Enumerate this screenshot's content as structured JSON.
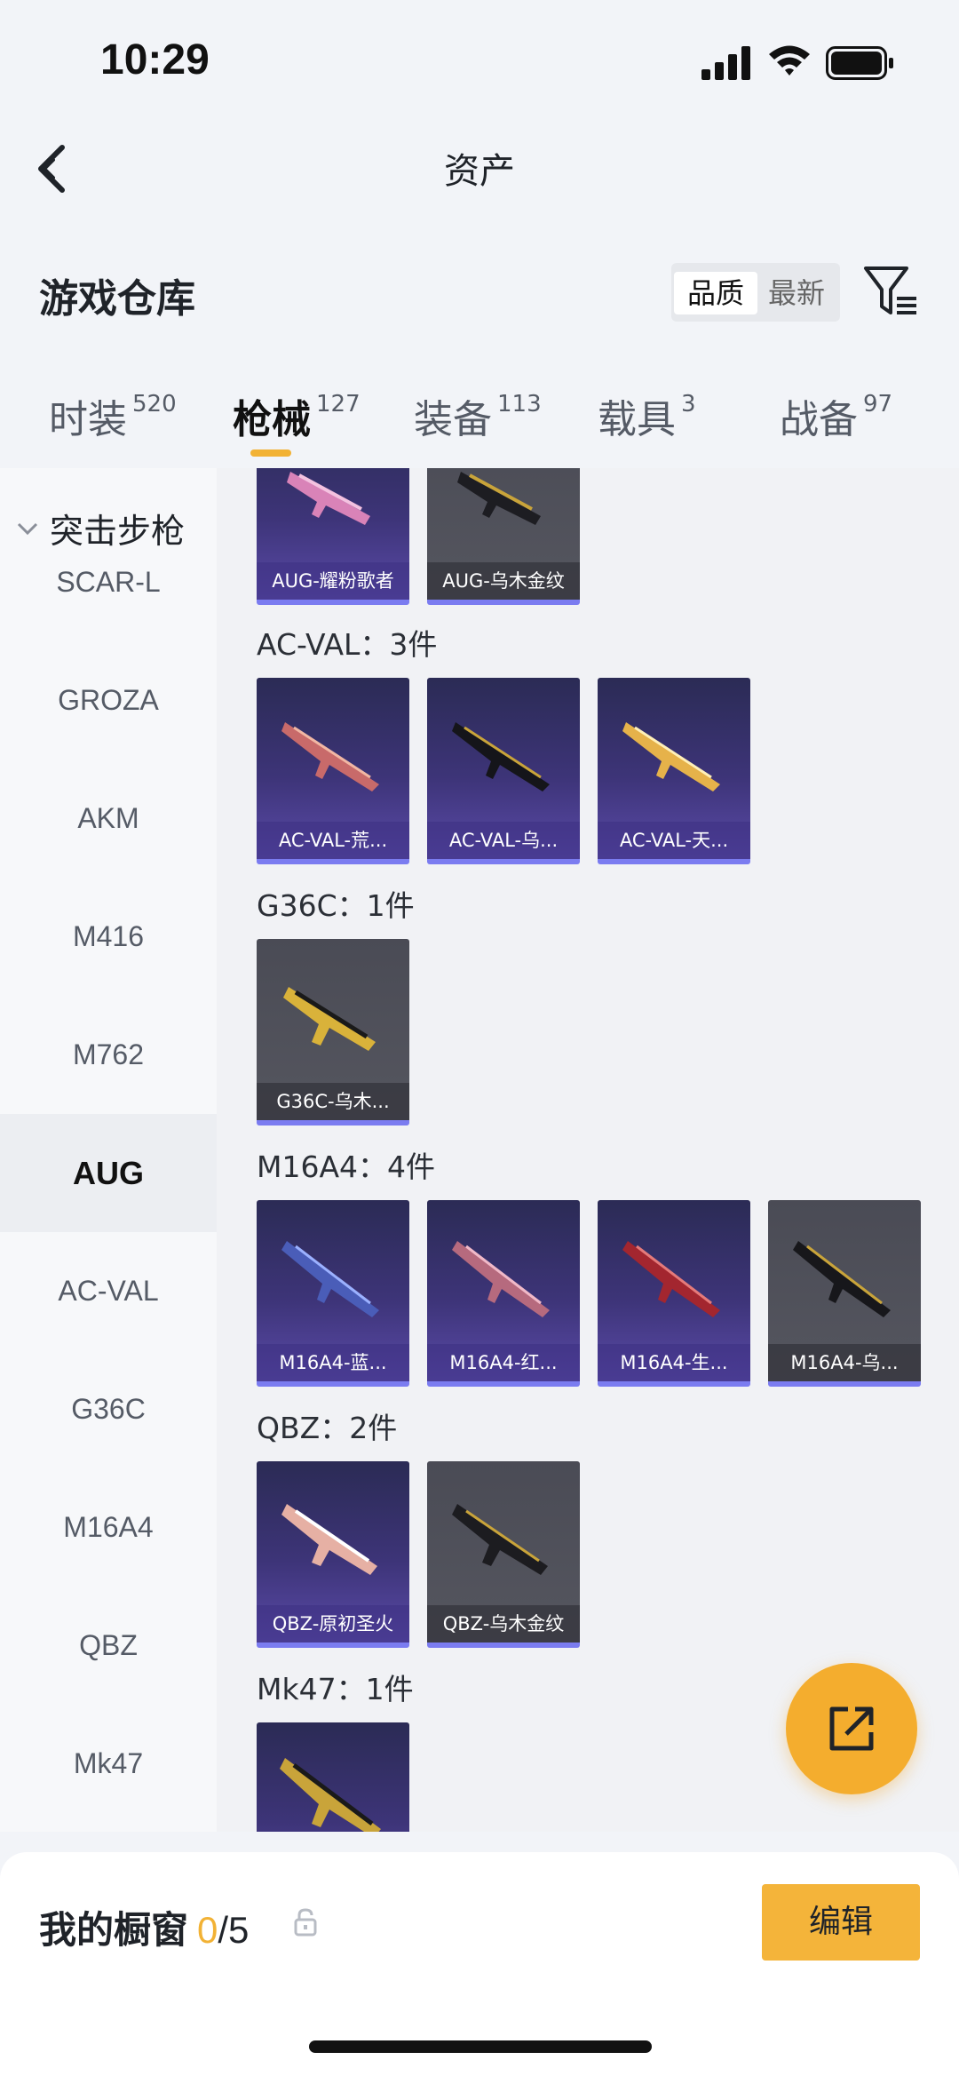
{
  "status": {
    "time": "10:29"
  },
  "nav": {
    "title": "资产"
  },
  "warehouse": {
    "title": "游戏仓库",
    "sort_quality": "品质",
    "sort_latest": "最新"
  },
  "tabs": [
    {
      "label": "时装",
      "count": "520"
    },
    {
      "label": "枪械",
      "count": "127"
    },
    {
      "label": "装备",
      "count": "113"
    },
    {
      "label": "载具",
      "count": "3"
    },
    {
      "label": "战备",
      "count": "97"
    }
  ],
  "sidenav": {
    "group": "突击步枪",
    "items": [
      "SCAR-L",
      "GROZA",
      "AKM",
      "M416",
      "M762",
      "AUG",
      "AC-VAL",
      "G36C",
      "M16A4",
      "QBZ",
      "Mk47"
    ],
    "active": "AUG"
  },
  "sections": [
    {
      "title": "",
      "items": [
        "AUG-耀粉歌者",
        "AUG-乌木金纹"
      ]
    },
    {
      "title": "AC-VAL：3件",
      "items": [
        "AC-VAL-荒...",
        "AC-VAL-乌...",
        "AC-VAL-天..."
      ]
    },
    {
      "title": "G36C：1件",
      "items": [
        "G36C-乌木..."
      ]
    },
    {
      "title": "M16A4：4件",
      "items": [
        "M16A4-蓝...",
        "M16A4-红...",
        "M16A4-生...",
        "M16A4-乌..."
      ]
    },
    {
      "title": "QBZ：2件",
      "items": [
        "QBZ-原初圣火",
        "QBZ-乌木金纹"
      ]
    },
    {
      "title": "Mk47：1件",
      "items": [
        ""
      ]
    }
  ],
  "bottom": {
    "label": "我的橱窗",
    "current": "0",
    "total": "/5",
    "edit": "编辑"
  },
  "colors": {
    "accent": "#f2b235",
    "rarity_purple": "#7b7cf0"
  }
}
